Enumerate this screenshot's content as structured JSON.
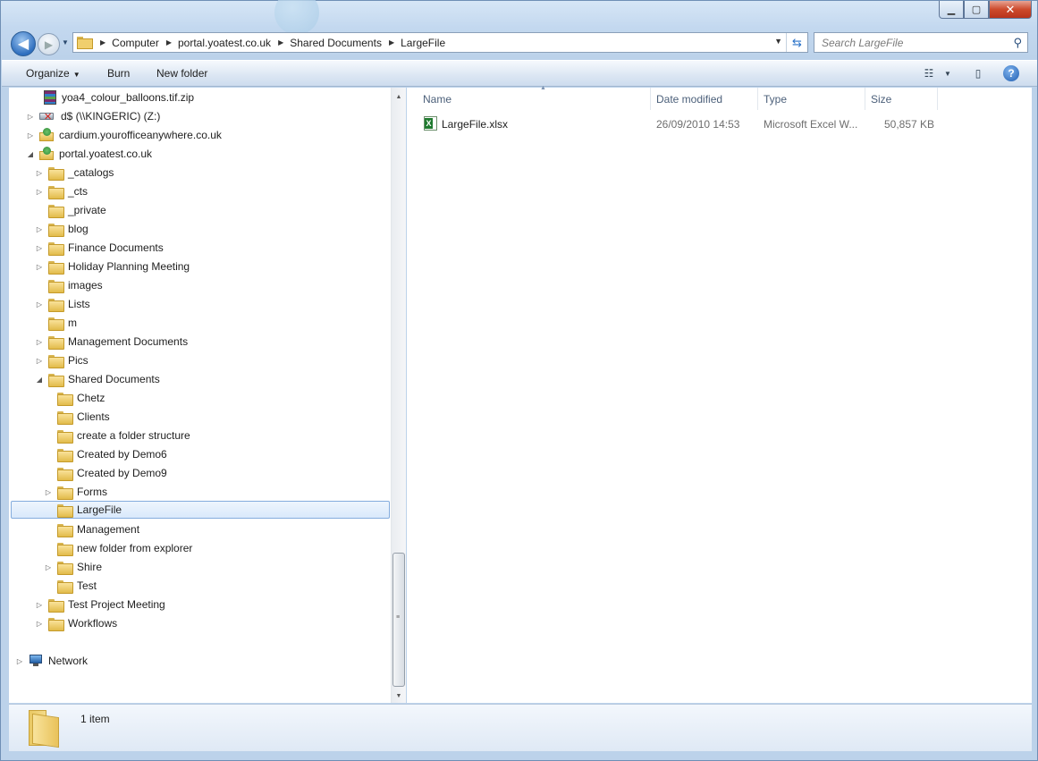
{
  "window": {
    "caption": {
      "minimize": "▁",
      "maximize": "▢",
      "close": "✕"
    }
  },
  "address": {
    "crumbs": [
      "Computer",
      "portal.yoatest.co.uk",
      "Shared Documents",
      "LargeFile"
    ]
  },
  "search": {
    "placeholder": "Search LargeFile"
  },
  "toolbar": {
    "organize": "Organize",
    "burn": "Burn",
    "new_folder": "New folder"
  },
  "tree": [
    {
      "label": "yoa4_colour_balloons.tif.zip",
      "icon": "zip-icon",
      "expander": ""
    },
    {
      "label": "d$ (\\\\KINGERIC) (Z:)",
      "icon": "disconnected-drive-icon",
      "expander": "▷"
    },
    {
      "label": "cardium.yourofficeanywhere.co.uk",
      "icon": "web-folder-icon",
      "expander": "▷"
    },
    {
      "label": "portal.yoatest.co.uk",
      "icon": "web-folder-icon",
      "expander": "◢"
    },
    {
      "label": "_catalogs",
      "icon": "folder-icon",
      "expander": "▷"
    },
    {
      "label": "_cts",
      "icon": "folder-icon",
      "expander": "▷"
    },
    {
      "label": "_private",
      "icon": "folder-icon",
      "expander": ""
    },
    {
      "label": "blog",
      "icon": "folder-icon",
      "expander": "▷"
    },
    {
      "label": "Finance Documents",
      "icon": "folder-icon",
      "expander": "▷"
    },
    {
      "label": "Holiday Planning Meeting",
      "icon": "folder-icon",
      "expander": "▷"
    },
    {
      "label": "images",
      "icon": "folder-icon",
      "expander": ""
    },
    {
      "label": "Lists",
      "icon": "folder-icon",
      "expander": "▷"
    },
    {
      "label": "m",
      "icon": "folder-icon",
      "expander": ""
    },
    {
      "label": "Management Documents",
      "icon": "folder-icon",
      "expander": "▷"
    },
    {
      "label": "Pics",
      "icon": "folder-icon",
      "expander": "▷"
    },
    {
      "label": "Shared Documents",
      "icon": "folder-icon",
      "expander": "◢"
    },
    {
      "label": "Chetz",
      "icon": "folder-icon",
      "expander": ""
    },
    {
      "label": "Clients",
      "icon": "folder-icon",
      "expander": ""
    },
    {
      "label": "create a folder structure",
      "icon": "folder-icon",
      "expander": ""
    },
    {
      "label": "Created by Demo6",
      "icon": "folder-icon",
      "expander": ""
    },
    {
      "label": "Created by Demo9",
      "icon": "folder-icon",
      "expander": ""
    },
    {
      "label": "Forms",
      "icon": "folder-icon",
      "expander": "▷"
    },
    {
      "label": "LargeFile",
      "icon": "folder-icon",
      "expander": "",
      "selected": true
    },
    {
      "label": "Management",
      "icon": "folder-icon",
      "expander": ""
    },
    {
      "label": "new folder from explorer",
      "icon": "folder-icon",
      "expander": ""
    },
    {
      "label": "Shire",
      "icon": "folder-icon",
      "expander": "▷"
    },
    {
      "label": "Test",
      "icon": "folder-icon",
      "expander": ""
    },
    {
      "label": "Test Project Meeting",
      "icon": "folder-icon",
      "expander": "▷"
    },
    {
      "label": "Workflows",
      "icon": "folder-icon",
      "expander": "▷"
    },
    {
      "label": "Network",
      "icon": "network-icon",
      "expander": "▷"
    }
  ],
  "columns": {
    "name": "Name",
    "date": "Date modified",
    "type": "Type",
    "size": "Size"
  },
  "files": [
    {
      "name": "LargeFile.xlsx",
      "date": "26/09/2010 14:53",
      "type": "Microsoft Excel W...",
      "size": "50,857 KB",
      "icon": "excel-file-icon"
    }
  ],
  "status": {
    "item_count": "1 item"
  }
}
